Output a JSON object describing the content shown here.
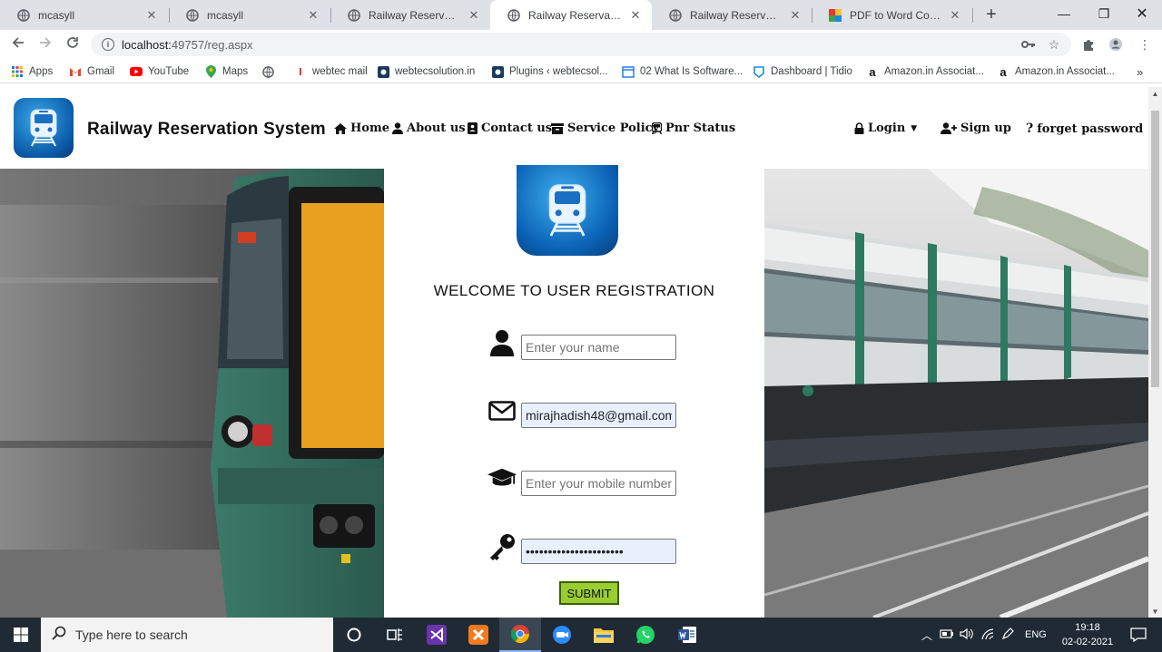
{
  "browser": {
    "tabs": [
      {
        "title": "mcasyll",
        "active": false
      },
      {
        "title": "mcasyll",
        "active": false
      },
      {
        "title": "Railway Reservation System",
        "active": false
      },
      {
        "title": "Railway Reservation System",
        "active": true
      },
      {
        "title": "Railway Reservation System",
        "active": false
      },
      {
        "title": "PDF to Word Converter",
        "active": false
      }
    ],
    "url_host": "localhost:",
    "url_path": "49757/reg.aspx",
    "bookmarks": [
      {
        "label": "Apps"
      },
      {
        "label": "Gmail"
      },
      {
        "label": "YouTube"
      },
      {
        "label": "Maps"
      },
      {
        "label": ""
      },
      {
        "label": "webtec mail"
      },
      {
        "label": "webtecsolution.in"
      },
      {
        "label": "Plugins ‹ webtecsol..."
      },
      {
        "label": "02 What Is Software..."
      },
      {
        "label": "Dashboard | Tidio"
      },
      {
        "label": "Amazon.in Associat..."
      },
      {
        "label": "Amazon.in Associat..."
      }
    ]
  },
  "site": {
    "brand": "Railway Reservation System",
    "nav": {
      "home": "Home",
      "about": "About us",
      "contact": "Contact us",
      "service": "Service Policy",
      "pnr": "Pnr Status",
      "login": "Login",
      "signup": "Sign up",
      "forget": "forget password"
    }
  },
  "form": {
    "title": "WELCOME TO USER REGISTRATION",
    "name_placeholder": "Enter your name",
    "email_value": "mirajhadish48@gmail.com",
    "mobile_placeholder": "Enter your mobile number",
    "password_value": "password1234567890abcd",
    "submit_label": "SUBMIT"
  },
  "taskbar": {
    "search_placeholder": "Type here to search",
    "language": "ENG",
    "time": "19:18",
    "date": "02-02-2021"
  },
  "colors": {
    "submit_bg": "#9acd32",
    "logo_blue": "#0b62b5"
  }
}
